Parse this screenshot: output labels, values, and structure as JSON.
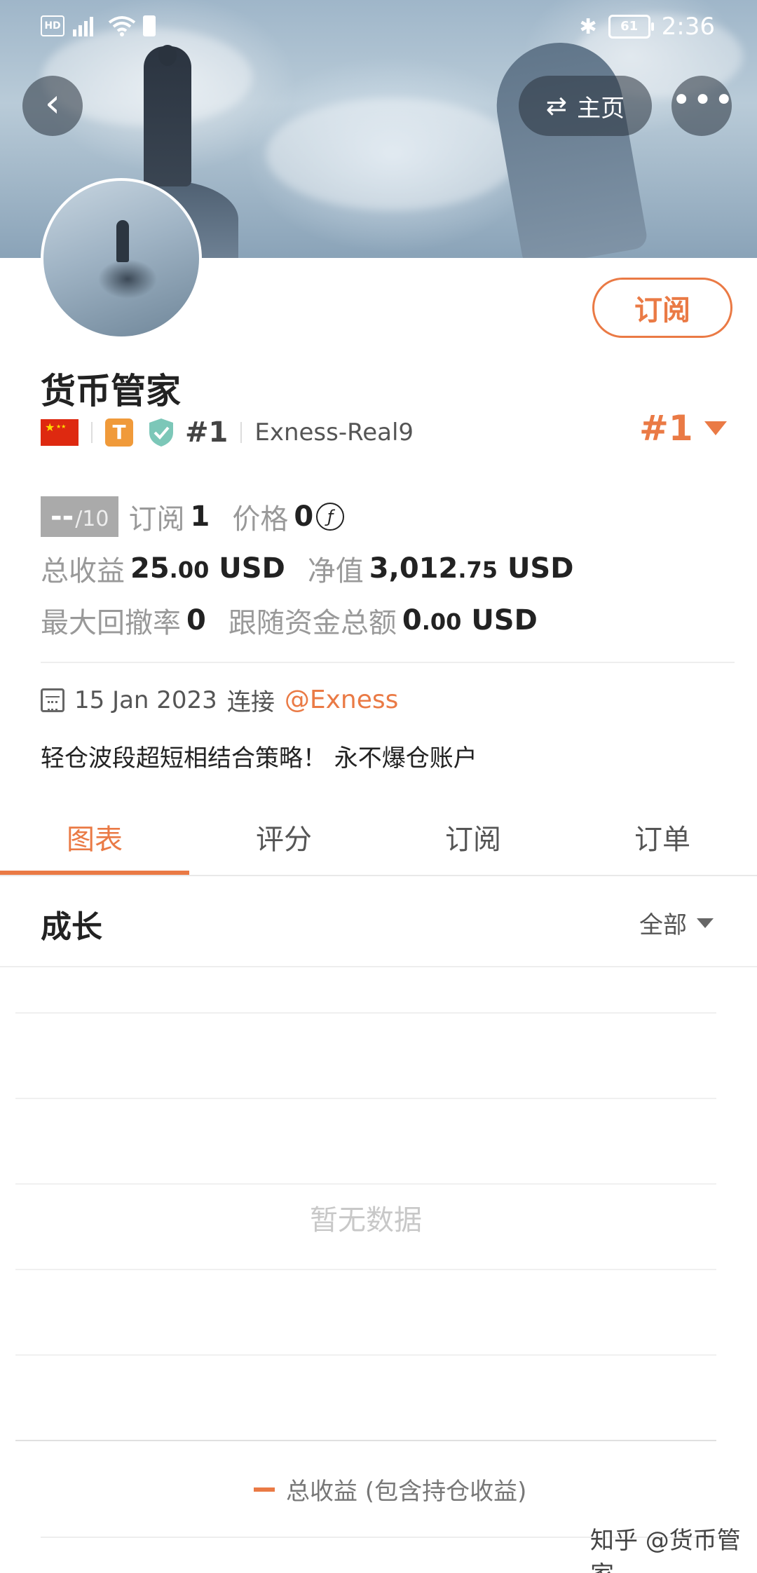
{
  "status_bar": {
    "time": "2:36",
    "battery": "61",
    "hd": "HD",
    "network": "4G"
  },
  "nav": {
    "back_icon": "chevron-left-icon",
    "home_label": "主页",
    "home_icon": "swap-icon",
    "more_icon": "more-icon"
  },
  "profile": {
    "name": "货币管家",
    "subscribe_label": "订阅",
    "badge_t": "T",
    "rank_small": "#1",
    "account": "Exness-Real9",
    "rank_big": "#1",
    "country_flag": "flag-china-icon"
  },
  "stats": {
    "score_main": "--",
    "score_total": "/10",
    "subscribe_label": "订阅",
    "subscribe_value": "1",
    "price_label": "价格",
    "price_value": "0",
    "price_icon": "ƒ",
    "total_profit_label": "总收益",
    "total_profit_int": "25",
    "total_profit_dec": ".00",
    "total_profit_unit": "USD",
    "equity_label": "净值",
    "equity_int": "3,012",
    "equity_dec": ".75",
    "equity_unit": "USD",
    "max_drawdown_label": "最大回撤率",
    "max_drawdown_value": "0",
    "follow_funds_label": "跟随资金总额",
    "follow_funds_int": "0",
    "follow_funds_dec": ".00",
    "follow_funds_unit": "USD"
  },
  "joined": {
    "date": "15 Jan 2023",
    "connect_label": "连接",
    "broker": "@Exness"
  },
  "description": "轻仓波段超短相结合策略！ 永不爆仓账户",
  "tabs": [
    {
      "label": "图表",
      "active": true
    },
    {
      "label": "评分",
      "active": false
    },
    {
      "label": "订阅",
      "active": false
    },
    {
      "label": "订单",
      "active": false
    }
  ],
  "growth": {
    "title": "成长",
    "filter_label": "全部",
    "no_data": "暂无数据",
    "legend_label": "总收益 (包含持仓收益)"
  },
  "watermark": "知乎 @货币管家",
  "colors": {
    "accent": "#ea7a45"
  }
}
